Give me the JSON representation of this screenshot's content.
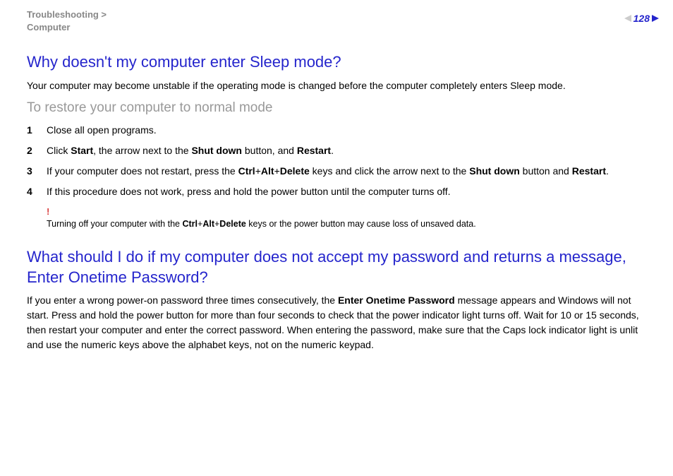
{
  "header": {
    "breadcrumb_line1": "Troubleshooting >",
    "breadcrumb_line2": "Computer",
    "page_number": "128"
  },
  "section1": {
    "heading": "Why doesn't my computer enter Sleep mode?",
    "intro": "Your computer may become unstable if the operating mode is changed before the computer completely enters Sleep mode.",
    "subheading": "To restore your computer to normal mode",
    "steps": [
      {
        "num": "1",
        "text_html": "Close all open programs."
      },
      {
        "num": "2",
        "text_html": "Click <b>Start</b>, the arrow next to the <b>Shut down</b> button, and <b>Restart</b>."
      },
      {
        "num": "3",
        "text_html": "If your computer does not restart, press the <b>Ctrl</b>+<b>Alt</b>+<b>Delete</b> keys and click the arrow next to the <b>Shut down</b> button and <b>Restart</b>."
      },
      {
        "num": "4",
        "text_html": "If this procedure does not work, press and hold the power button until the computer turns off."
      }
    ],
    "warning_mark": "!",
    "warning_html": "Turning off your computer with the <b>Ctrl</b>+<b>Alt</b>+<b>Delete</b> keys or the power button may cause loss of unsaved data."
  },
  "section2": {
    "heading": "What should I do if my computer does not accept my password and returns a message, Enter Onetime Password?",
    "body_html": "If you enter a wrong power-on password three times consecutively, the <b>Enter Onetime Password</b> message appears and Windows will not start. Press and hold the power button for more than four seconds to check that the power indicator light turns off. Wait for 10 or 15 seconds, then restart your computer and enter the correct password. When entering the password, make sure that the Caps lock indicator light is unlit and use the numeric keys above the alphabet keys, not on the numeric keypad."
  }
}
